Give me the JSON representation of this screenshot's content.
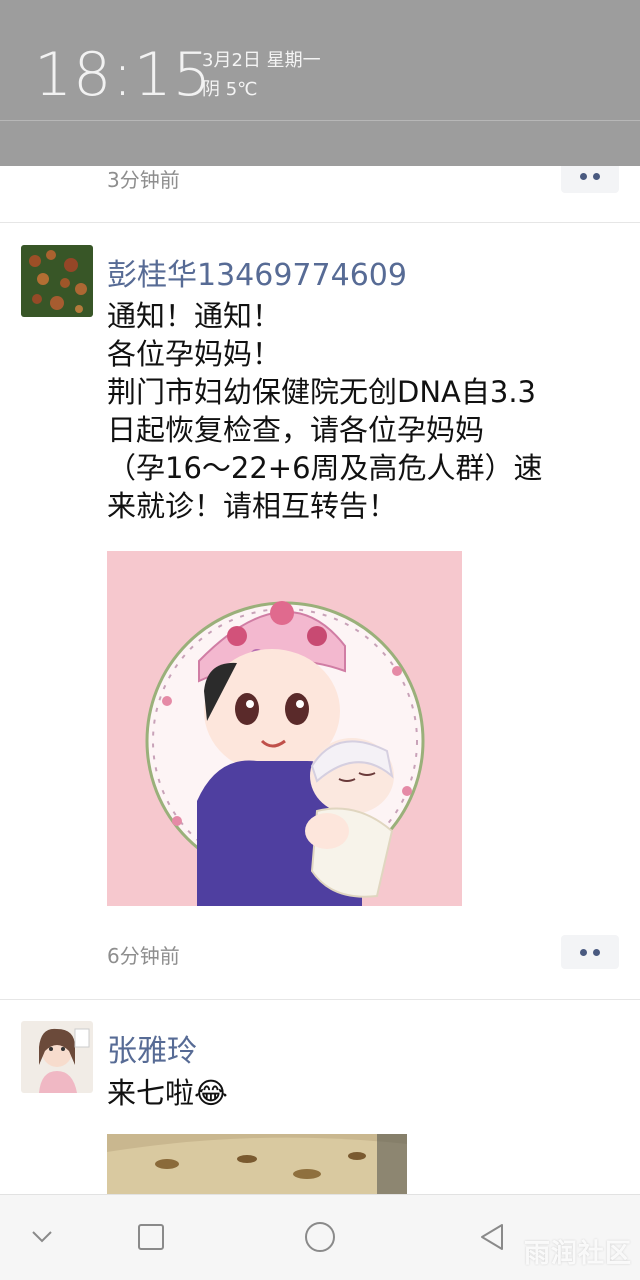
{
  "status_shade": {
    "time": "18:15",
    "date": "3月2日 星期一",
    "weather": "阴 5℃"
  },
  "posts": [
    {
      "time": "3分钟前"
    },
    {
      "author": "彭桂华13469774609",
      "lines": [
        "通知！通知！",
        "各位孕妈妈！",
        "荆门市妇幼保健院无创DNA自3.3",
        "日起恢复检查，请各位孕妈妈",
        "（孕16～22+6周及高危人群）速",
        "来就诊！请相互转告！"
      ],
      "time": "6分钟前"
    },
    {
      "author": "张雅玲",
      "text": "来七啦😂"
    }
  ],
  "nav": {
    "back": "back-icon",
    "home": "home-icon",
    "recents": "recents-icon",
    "down": "chevron-down-icon"
  },
  "watermark": "雨润社区",
  "colors": {
    "author_link": "#576b95",
    "shade": "#9d9d9d"
  }
}
